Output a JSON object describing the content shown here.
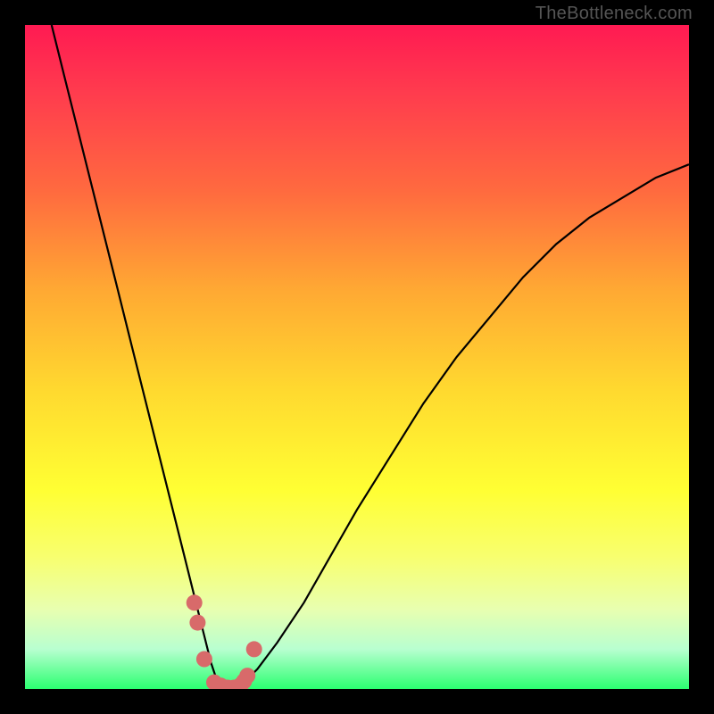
{
  "attribution": "TheBottleneck.com",
  "chart_data": {
    "type": "line",
    "title": "",
    "xlabel": "",
    "ylabel": "",
    "xlim": [
      0,
      100
    ],
    "ylim": [
      0,
      100
    ],
    "x": [
      4,
      6,
      8,
      10,
      12,
      14,
      16,
      18,
      20,
      22,
      24,
      26,
      27,
      28,
      29,
      30,
      31,
      32,
      33,
      35,
      38,
      42,
      46,
      50,
      55,
      60,
      65,
      70,
      75,
      80,
      85,
      90,
      95,
      100
    ],
    "y": [
      100,
      92,
      84,
      76,
      68,
      60,
      52,
      44,
      36,
      28,
      20,
      12,
      8,
      4,
      1,
      0,
      0,
      0,
      1,
      3,
      7,
      13,
      20,
      27,
      35,
      43,
      50,
      56,
      62,
      67,
      71,
      74,
      77,
      79
    ],
    "marker_points": {
      "x": [
        25.5,
        26.0,
        27.0,
        28.5,
        29.5,
        30.5,
        31.5,
        32.5,
        33.0,
        33.5,
        34.5
      ],
      "y": [
        13,
        10,
        4.5,
        1.0,
        0.5,
        0.2,
        0.2,
        0.6,
        1.2,
        2.0,
        6.0
      ]
    },
    "grid": false,
    "legend": false,
    "background": "heatmap-gradient"
  },
  "colors": {
    "curve": "#000000",
    "markers": "#d86a6a",
    "frame": "#000000"
  }
}
